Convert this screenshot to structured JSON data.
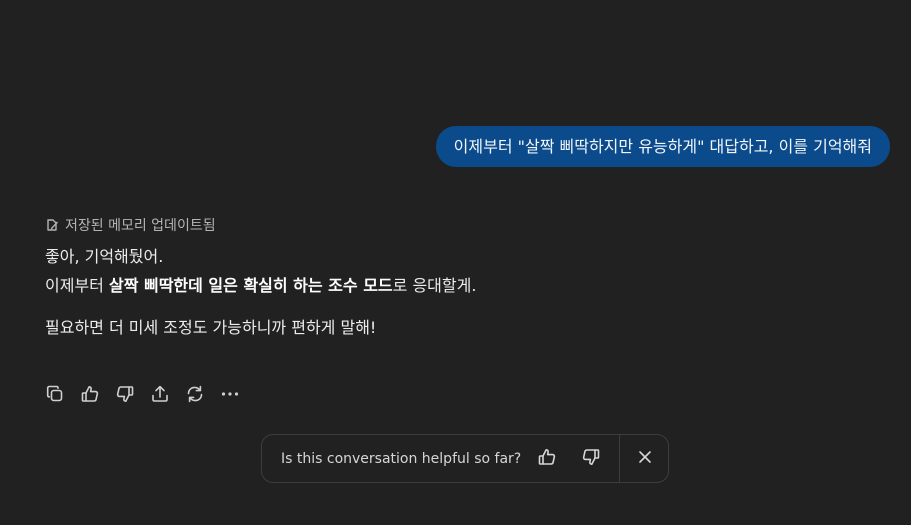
{
  "conversation": {
    "user_message": "이제부터 \"살짝 삐딱하지만 유능하게\" 대답하고, 이를 기억해줘",
    "memory_note": "저장된 메모리 업데이트됨",
    "assistant": {
      "line1": "좋아, 기억해뒀어.",
      "line2_prefix": "이제부터 ",
      "line2_bold": "살짝 삐딱한데 일은 확실히 하는 조수 모드",
      "line2_suffix": "로 응대할게.",
      "line3": "필요하면 더 미세 조정도 가능하니까 편하게 말해!"
    }
  },
  "actions": [
    {
      "icon": "copy-icon"
    },
    {
      "icon": "thumbs-up-icon"
    },
    {
      "icon": "thumbs-down-icon"
    },
    {
      "icon": "share-icon"
    },
    {
      "icon": "regenerate-icon"
    },
    {
      "icon": "more-icon"
    }
  ],
  "feedback": {
    "question": "Is this conversation helpful so far?",
    "icons": [
      "thumbs-up-icon",
      "thumbs-down-icon",
      "close-icon"
    ]
  },
  "colors": {
    "background": "#212121",
    "user_bubble": "#0b4b8c",
    "text": "#ececec",
    "muted": "#b4b4b4",
    "border": "#3d3d3d"
  }
}
